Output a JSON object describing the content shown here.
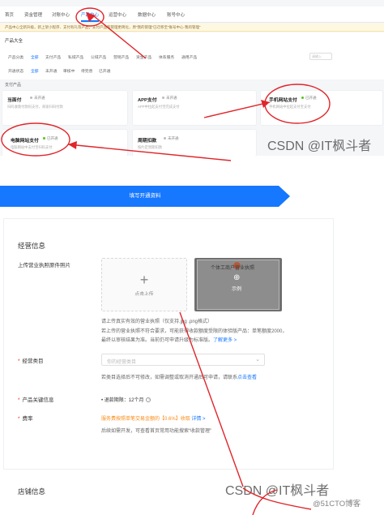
{
  "top_nav": {
    "items": [
      "首页",
      "资金管理",
      "对账中心",
      "产品中心",
      "运营中心",
      "数据中心",
      "账号中心"
    ],
    "active_index": 3
  },
  "notice": {
    "text": "产品中心全新升级，新上架小程序、支付有礼等产品，支付产品和管理更简化，原“我的管理”已迁移至“账号中心-我的管理”"
  },
  "product_list": {
    "title": "产品大全",
    "filter_row1_label": "产品分类",
    "filter_row1": [
      "全部",
      "支付产品",
      "私域产品",
      "公域产品",
      "营销产品",
      "资金产品",
      "体系服务",
      "通用产品"
    ],
    "filter_row1_active": 0,
    "search_placeholder": "请输入",
    "filter_row2_label": "开通状态",
    "filter_row2": [
      "全部",
      "未开通",
      "审核中",
      "待完善",
      "已开通"
    ],
    "filter_row2_active": 0
  },
  "pay_section": {
    "title": "支付产品"
  },
  "cards": [
    {
      "title": "当面付",
      "status": "未开通",
      "desc": "扫码收款付款码支付，商家扫码付款"
    },
    {
      "title": "APP支付",
      "status": "未开通",
      "desc": "APP中拉起支付宝完成支付"
    },
    {
      "title": "手机网站支付",
      "status": "已开通",
      "desc": "手机网站中拉起支付宝支付"
    },
    {
      "title": "电脑网站支付",
      "status": "已开通",
      "desc": "电脑网站中支付宝扫码支付"
    },
    {
      "title": "周期扣款",
      "status": "未开通",
      "desc": "按约定周期扣款"
    }
  ],
  "watermark1": "CSDN @IT枫斗者",
  "banner": {
    "label": "填写开通资料"
  },
  "business_info": {
    "title": "经营信息",
    "license_label": "上传营业执照原件照片",
    "upload_text": "点击上传",
    "sample_title": "个体工商户营业执照",
    "sample_label": "示例",
    "help_line1": "请上传真实有效的营业执照（仅支持.jpg .png格式）",
    "help_line2": "若上传的营业执照不符合要求，可能获得收款额度受限的体验版产品：单笔额度2000，",
    "help_line3_prefix": "最终以审核结果为准。当前仍可申请升级为标准版。",
    "help_line3_link": "了解更多 >",
    "category_label": "经营类目",
    "category_placeholder": "你的经营类目",
    "category_help_prefix": "若类目选择后不可修改，如需调整或取消开通后可申请，请联系",
    "category_help_link": "点击查看",
    "keyinfo_label": "产品关键信息",
    "keyinfo_value": "• 退款期限：12个月",
    "rate_label": "费率",
    "rate_prefix": "服务费按照单笔交易金额的",
    "rate_value": "【0.6%】",
    "rate_suffix": "收取",
    "rate_link": "详情 >",
    "rate_help": "后续如需开发，可查看首页常用功能搜索“收款管理”"
  },
  "shop_info": {
    "title": "店铺信息"
  },
  "watermark2": "CSDN @IT枫斗者",
  "watermark3": "@51CTO博客",
  "colors": {
    "primary": "#1677ff",
    "annotation_red": "#e0262b",
    "rate_orange": "#fa8c16",
    "status_green": "#52c41a"
  }
}
